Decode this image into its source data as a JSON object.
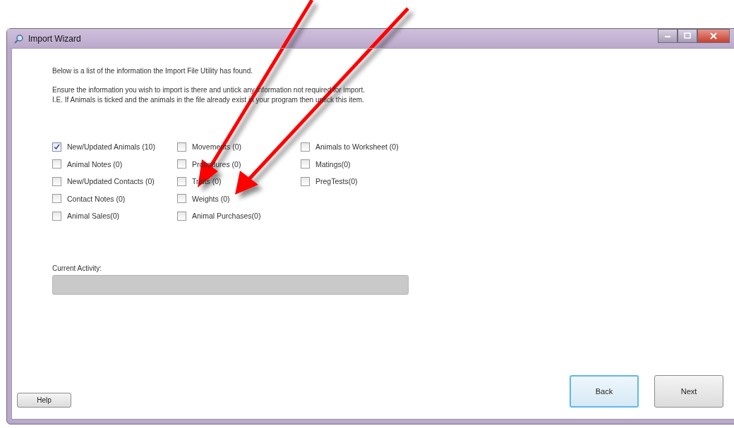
{
  "window": {
    "title": "Import Wizard"
  },
  "intro": "Below is a list of the information the Import File Utility has found.",
  "instructions": [
    "Ensure the information you wish to import is there and untick any information not required for import.",
    "I.E. If Animals is ticked and the animals in the file already exist in your program then untick this item."
  ],
  "options": [
    [
      {
        "label": "New/Updated Animals (10)",
        "checked": true
      },
      {
        "label": "Animal Notes (0)",
        "checked": false
      },
      {
        "label": "New/Updated Contacts (0)",
        "checked": false
      },
      {
        "label": "Contact Notes (0)",
        "checked": false
      },
      {
        "label": "Animal Sales(0)",
        "checked": false
      }
    ],
    [
      {
        "label": "Movements (0)",
        "checked": false
      },
      {
        "label": "Procedures (0)",
        "checked": false
      },
      {
        "label": "Traits (0)",
        "checked": false
      },
      {
        "label": "Weights (0)",
        "checked": false
      },
      {
        "label": "Animal Purchases(0)",
        "checked": false
      }
    ],
    [
      {
        "label": "Animals to Worksheet (0)",
        "checked": false
      },
      {
        "label": "Matings(0)",
        "checked": false
      },
      {
        "label": "PregTests(0)",
        "checked": false
      }
    ]
  ],
  "activity": {
    "label": "Current Activity:",
    "level": 0
  },
  "buttons": [
    {
      "label": "Help",
      "focused": false
    },
    {
      "label": "Back",
      "focused": true
    },
    {
      "label": "Next",
      "focused": false
    }
  ]
}
